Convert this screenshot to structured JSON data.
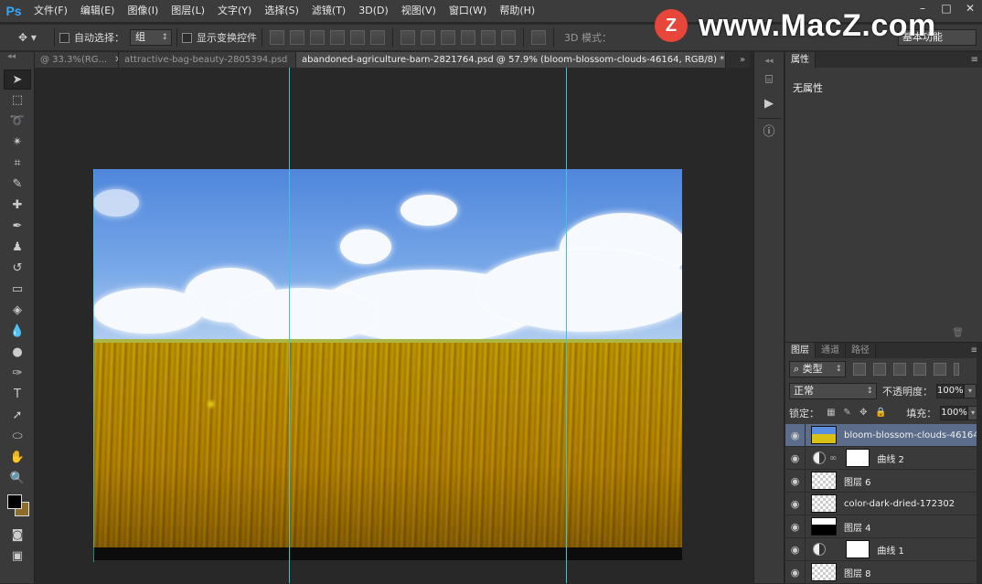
{
  "app": {
    "logo": "Ps"
  },
  "menu": [
    "文件(F)",
    "编辑(E)",
    "图像(I)",
    "图层(L)",
    "文字(Y)",
    "选择(S)",
    "滤镜(T)",
    "3D(D)",
    "视图(V)",
    "窗口(W)",
    "帮助(H)"
  ],
  "window_buttons": [
    "–",
    "□",
    "✕"
  ],
  "watermark": {
    "logo_letter": "Z",
    "text": "www.MacZ.com"
  },
  "options": {
    "auto_select_label": "自动选择：",
    "auto_select_value": "组",
    "show_transform_label": "显示变换控件",
    "mode3d_label": "3D 模式：",
    "workspace": "基本功能"
  },
  "tabs": [
    {
      "label": "@ 33.3%(RG...",
      "active": false
    },
    {
      "label": "attractive-bag-beauty-2805394.psd",
      "active": false
    },
    {
      "label": "abandoned-agriculture-barn-2821764.psd @ 57.9% (bloom-blossom-clouds-46164, RGB/8) *",
      "active": true
    }
  ],
  "panels": {
    "properties_tab": "属性",
    "properties_text": "无属性",
    "layers_tabs": [
      "图层",
      "通道",
      "路径"
    ]
  },
  "layers_panel": {
    "filter_label": "类型",
    "blend_mode": "正常",
    "opacity_label": "不透明度：",
    "opacity_value": "100%",
    "lock_label": "锁定：",
    "fill_label": "填充：",
    "fill_value": "100%",
    "layers": [
      {
        "name": "bloom-blossom-clouds-46164",
        "thumb": "photo",
        "selected": true
      },
      {
        "name": "曲线 2",
        "thumb": "adjustment"
      },
      {
        "name": "图层 6",
        "thumb": "transparent"
      },
      {
        "name": "color-dark-dried-172302",
        "thumb": "transparent"
      },
      {
        "name": "图层 4",
        "thumb": "shape"
      },
      {
        "name": "曲线 1",
        "thumb": "adjustment"
      },
      {
        "name": "图层 8",
        "thumb": "transparent"
      }
    ]
  },
  "colors": {
    "foreground": "#000000",
    "background": "#8c6d2b",
    "guide": "#39c6d8",
    "selected_layer": "#5b6d8a"
  }
}
